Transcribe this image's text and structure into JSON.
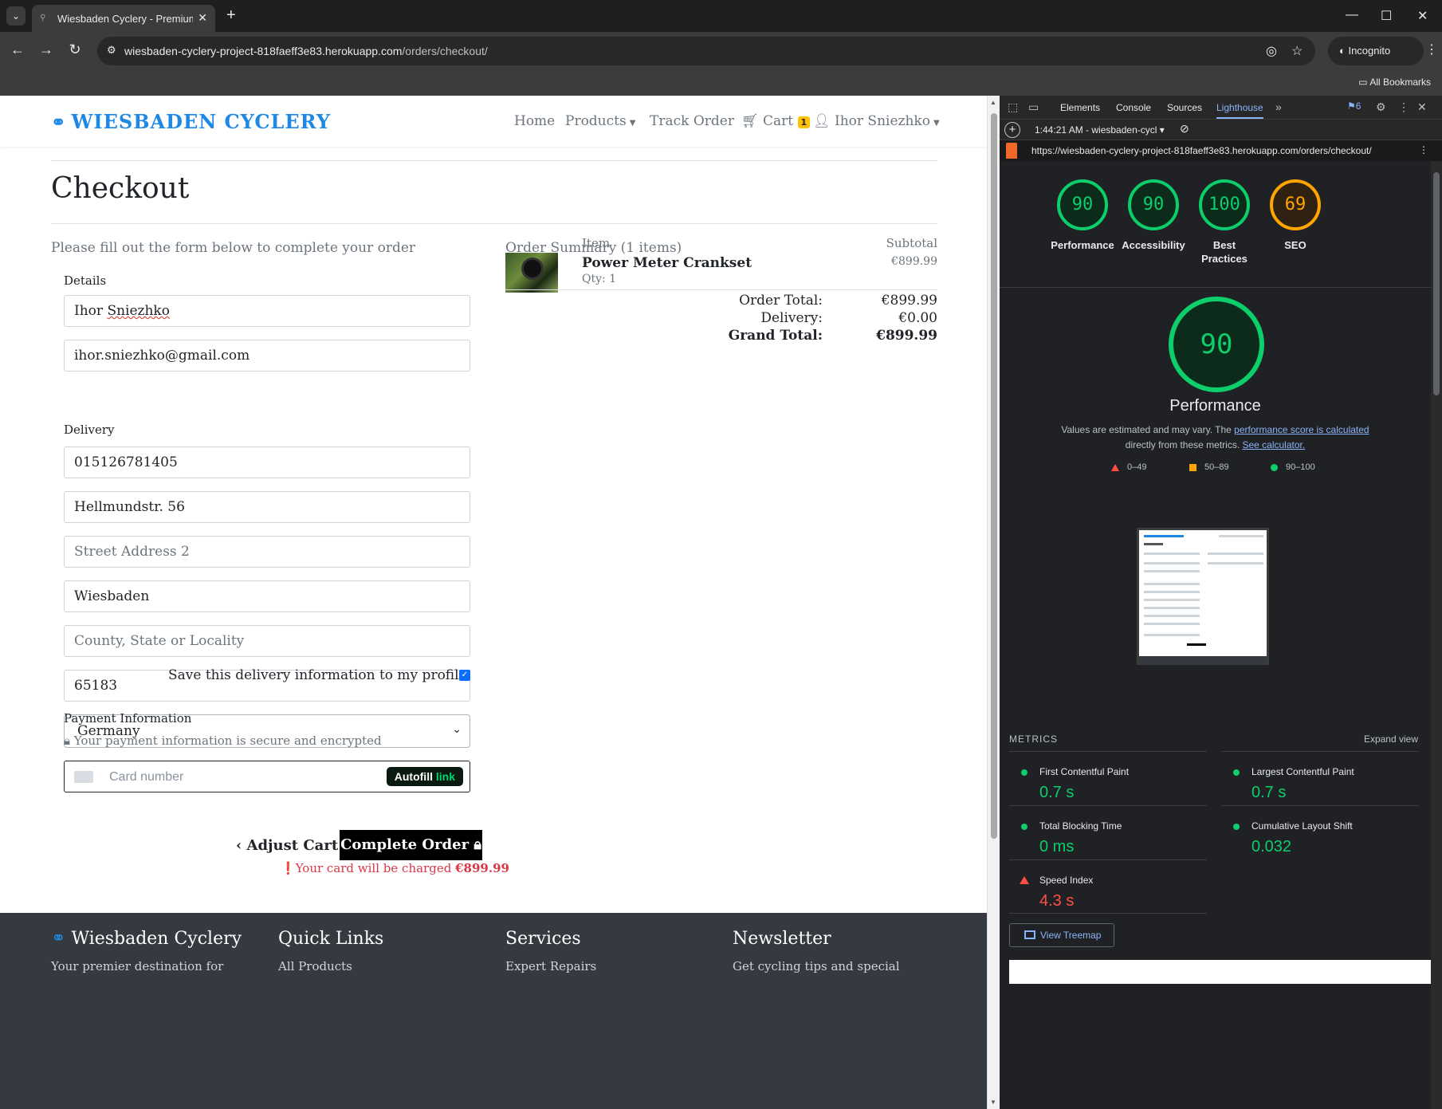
{
  "browser": {
    "tab_title": "Wiesbaden Cyclery - Premium B",
    "url_host": "wiesbaden-cyclery-project-818faeff3e83.herokuapp.com",
    "url_path": "/orders/checkout/",
    "incognito_label": "Incognito",
    "all_bookmarks": "All Bookmarks"
  },
  "site": {
    "brand": "WIESBADEN CYCLERY",
    "nav": {
      "home": "Home",
      "products": "Products",
      "track": "Track Order",
      "cart": "Cart",
      "cart_count": "1",
      "user": "Ihor Sniezhko"
    }
  },
  "checkout": {
    "title": "Checkout",
    "subtitle": "Please fill out the form below to complete your order",
    "details_legend": "Details",
    "name_value": "Ihor Sniezhko",
    "name_first": "Ihor ",
    "name_last": "Sniezhko",
    "email_value": "ihor.sniezhko@gmail.com",
    "delivery_legend": "Delivery",
    "phone_value": "015126781405",
    "street1_value": "Hellmundstr. 56",
    "street2_placeholder": "Street Address 2",
    "city_value": "Wiesbaden",
    "county_placeholder": "County, State or Locality",
    "postcode_value": "65183",
    "country_value": "Germany",
    "save_label": "Save this delivery information to my profile",
    "save_checked": true,
    "payment_legend": "Payment Information",
    "secure_note": "Your payment information is secure and encrypted",
    "card_placeholder": "Card number",
    "autofill_label": "Autofill",
    "autofill_link": "link",
    "adjust_cart": "Adjust Cart",
    "complete_order": "Complete Order",
    "charged_text": "Your card will be charged",
    "charged_amount": "€899.99"
  },
  "summary": {
    "title": "Order Summary (1 items)",
    "col_item": "Item",
    "col_subtotal": "Subtotal",
    "product_name": "Power Meter Crankset",
    "product_qty": "Qty: 1",
    "product_price": "€899.99",
    "order_total_label": "Order Total:",
    "order_total": "€899.99",
    "delivery_label": "Delivery:",
    "delivery": "€0.00",
    "grand_total_label": "Grand Total:",
    "grand_total": "€899.99"
  },
  "footer": {
    "col1": "Wiesbaden Cyclery",
    "col2": "Quick Links",
    "col3": "Services",
    "col4": "Newsletter",
    "col1_text": "Your premier destination for",
    "col2_text": "All Products",
    "col3_text": "Expert Repairs",
    "col4_text": "Get cycling tips and special"
  },
  "devtools": {
    "tabs": [
      "Elements",
      "Console",
      "Sources",
      "Lighthouse"
    ],
    "active_tab": "Lighthouse",
    "issues_count": "6",
    "report_label": "1:44:21 AM - wiesbaden-cycl",
    "report_url": "https://wiesbaden-cyclery-project-818faeff3e83.herokuapp.com/orders/checkout/",
    "scores": [
      {
        "label": "Performance",
        "value": "90",
        "color": "#0cce6b"
      },
      {
        "label": "Accessibility",
        "value": "90",
        "color": "#0cce6b"
      },
      {
        "label": "Best Practices",
        "value": "100",
        "color": "#0cce6b"
      },
      {
        "label": "SEO",
        "value": "69",
        "color": "#ffa400"
      }
    ],
    "perf_score": "90",
    "perf_title": "Performance",
    "note_pre": "Values are estimated and may vary. The ",
    "note_link1": "performance score is calculated",
    "note_mid": "directly from these metrics. ",
    "note_link2": "See calculator.",
    "legend": [
      "0–49",
      "50–89",
      "90–100"
    ],
    "metrics_header": "METRICS",
    "expand_view": "Expand view",
    "metrics": [
      {
        "name": "First Contentful Paint",
        "value": "0.7 s",
        "status": "pass"
      },
      {
        "name": "Largest Contentful Paint",
        "value": "0.7 s",
        "status": "pass"
      },
      {
        "name": "Total Blocking Time",
        "value": "0 ms",
        "status": "pass"
      },
      {
        "name": "Cumulative Layout Shift",
        "value": "0.032",
        "status": "pass"
      },
      {
        "name": "Speed Index",
        "value": "4.3 s",
        "status": "fail"
      }
    ],
    "treemap_button": "View Treemap"
  }
}
